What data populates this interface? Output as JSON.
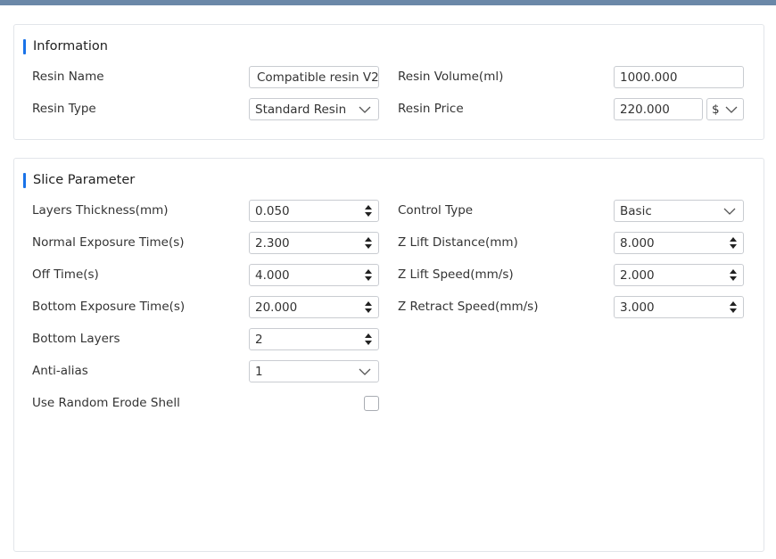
{
  "information": {
    "title": "Information",
    "resin_name_label": "Resin Name",
    "resin_name_value": "Compatible resin V2",
    "resin_type_label": "Resin Type",
    "resin_type_value": "Standard Resin",
    "resin_volume_label": "Resin Volume(ml)",
    "resin_volume_value": "1000.000",
    "resin_price_label": "Resin Price",
    "resin_price_value": "220.000",
    "currency_value": "$"
  },
  "slice": {
    "title": "Slice Parameter",
    "layers_thickness_label": "Layers Thickness(mm)",
    "layers_thickness_value": "0.050",
    "normal_exposure_label": "Normal Exposure Time(s)",
    "normal_exposure_value": "2.300",
    "off_time_label": "Off Time(s)",
    "off_time_value": "4.000",
    "bottom_exposure_label": "Bottom Exposure Time(s)",
    "bottom_exposure_value": "20.000",
    "bottom_layers_label": "Bottom Layers",
    "bottom_layers_value": "2",
    "anti_alias_label": "Anti-alias",
    "anti_alias_value": "1",
    "random_erode_label": "Use Random Erode Shell",
    "random_erode_checked": false,
    "control_type_label": "Control Type",
    "control_type_value": "Basic",
    "z_lift_distance_label": "Z Lift Distance(mm)",
    "z_lift_distance_value": "8.000",
    "z_lift_speed_label": "Z Lift Speed(mm/s)",
    "z_lift_speed_value": "2.000",
    "z_retract_speed_label": "Z Retract Speed(mm/s)",
    "z_retract_speed_value": "3.000"
  },
  "colors": {
    "accent": "#1a73e8",
    "topbar": "#6b88a8"
  }
}
